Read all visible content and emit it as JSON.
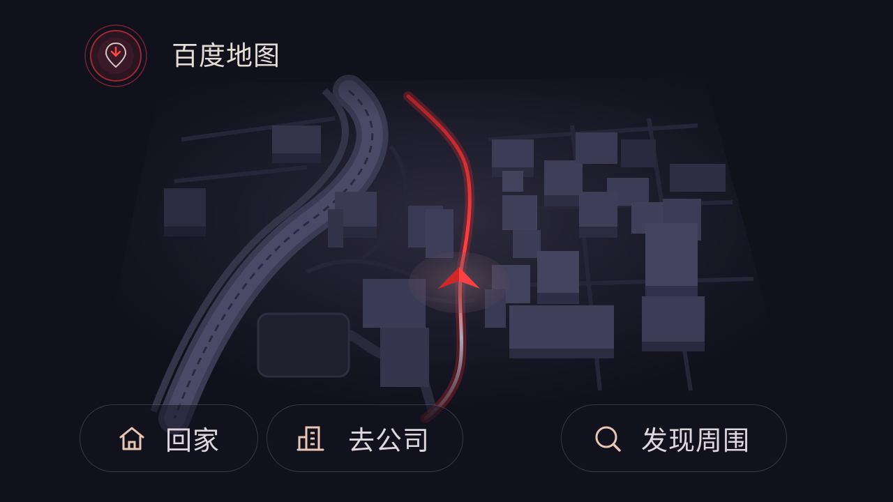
{
  "app": {
    "title": "百度地图",
    "logo_icon": "map-pin-icon"
  },
  "shortcuts": [
    {
      "label": "回家",
      "icon": "home-icon"
    },
    {
      "label": "去公司",
      "icon": "office-building-icon"
    },
    {
      "label": "发现周围",
      "icon": "search-icon"
    }
  ],
  "colors": {
    "background": "#11111c",
    "route": "#ff3b3b",
    "accent": "#e8463c",
    "text": "#e0dad8"
  }
}
